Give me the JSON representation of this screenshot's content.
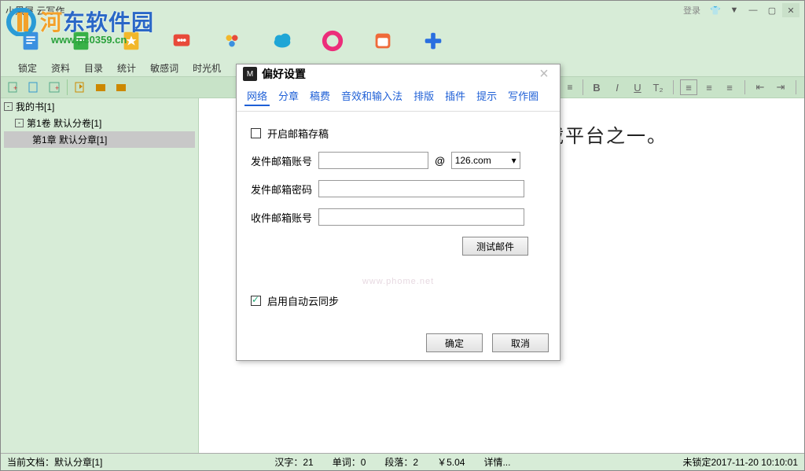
{
  "window": {
    "title": "小黑屋    云写作",
    "login": "登录"
  },
  "menus": [
    "锁定",
    "资料",
    "目录",
    "统计",
    "敏感词",
    "时光机"
  ],
  "tree": {
    "root": "我的书[1]",
    "vol": "第1卷 默认分卷[1]",
    "chap": "第1章 默认分章[1]"
  },
  "editor": {
    "line": "载平台之一。"
  },
  "format_labels": {
    "bold": "B",
    "italic": "I",
    "underline": "U",
    "sub": "T₂"
  },
  "dialog": {
    "title": "偏好设置",
    "tabs": [
      "网络",
      "分章",
      "稿费",
      "音效和输入法",
      "排版",
      "插件",
      "提示",
      "写作圈"
    ],
    "chk_email_draft": "开启邮箱存稿",
    "lbl_send_acct": "发件邮箱账号",
    "lbl_send_pass": "发件邮箱密码",
    "lbl_recv_acct": "收件邮箱账号",
    "combo_domain": "126.com",
    "btn_test": "测试邮件",
    "chk_cloud": "启用自动云同步",
    "ok": "确定",
    "cancel": "取消",
    "watermark": "www.phome.net"
  },
  "status": {
    "doc_prefix": "当前文档：",
    "doc_name": "默认分章[1]",
    "hanzi": "汉字：21",
    "words": "单词：0",
    "paras": "段落：2",
    "money": "￥5.04",
    "detail": "详情...",
    "lock": "未锁定",
    "time": "2017-11-20 10:10:01"
  },
  "watermark": {
    "brand_a": "河",
    "brand_b": "东软件园",
    "url": "www.pc0359.cn"
  }
}
